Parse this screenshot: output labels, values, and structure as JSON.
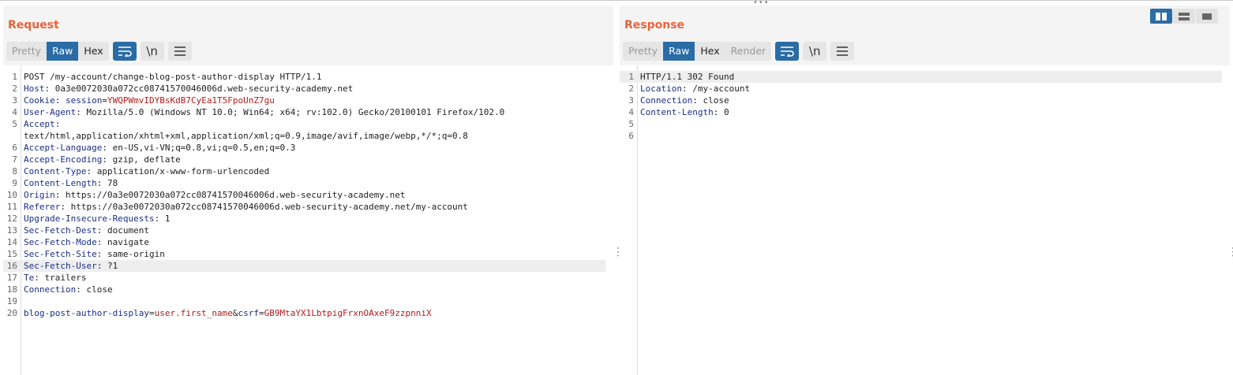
{
  "request": {
    "title": "Request",
    "tabs": [
      "Pretty",
      "Raw",
      "Hex"
    ],
    "lines": [
      {
        "n": "1",
        "k": "",
        "v": "POST /my-account/change-blog-post-author-display HTTP/1.1"
      },
      {
        "n": "2",
        "k": "Host",
        "v": "0a3e0072030a072cc08741570046006d.web-security-academy.net"
      },
      {
        "n": "3",
        "k": "Cookie",
        "v": "",
        "cookie_name": "session",
        "cookie_value": "YWQPWmvIDYBsKdB7CyEa1T5FpoUnZ7gu"
      },
      {
        "n": "4",
        "k": "User-Agent",
        "v": "Mozilla/5.0 (Windows NT 10.0; Win64; x64; rv:102.0) Gecko/20100101 Firefox/102.0"
      },
      {
        "n": "5",
        "k": "Accept",
        "v": ""
      },
      {
        "n": "",
        "k": "",
        "v": "text/html,application/xhtml+xml,application/xml;q=0.9,image/avif,image/webp,*/*;q=0.8"
      },
      {
        "n": "6",
        "k": "Accept-Language",
        "v": "en-US,vi-VN;q=0.8,vi;q=0.5,en;q=0.3"
      },
      {
        "n": "7",
        "k": "Accept-Encoding",
        "v": "gzip, deflate"
      },
      {
        "n": "8",
        "k": "Content-Type",
        "v": "application/x-www-form-urlencoded"
      },
      {
        "n": "9",
        "k": "Content-Length",
        "v": "78"
      },
      {
        "n": "10",
        "k": "Origin",
        "v": "https://0a3e0072030a072cc08741570046006d.web-security-academy.net"
      },
      {
        "n": "11",
        "k": "Referer",
        "v": "https://0a3e0072030a072cc08741570046006d.web-security-academy.net/my-account"
      },
      {
        "n": "12",
        "k": "Upgrade-Insecure-Requests",
        "v": "1"
      },
      {
        "n": "13",
        "k": "Sec-Fetch-Dest",
        "v": "document"
      },
      {
        "n": "14",
        "k": "Sec-Fetch-Mode",
        "v": "navigate"
      },
      {
        "n": "15",
        "k": "Sec-Fetch-Site",
        "v": "same-origin"
      },
      {
        "n": "16",
        "k": "Sec-Fetch-User",
        "v": "?1",
        "highlight": true
      },
      {
        "n": "17",
        "k": "Te",
        "v": "trailers"
      },
      {
        "n": "18",
        "k": "Connection",
        "v": "close"
      },
      {
        "n": "19",
        "k": "",
        "v": ""
      },
      {
        "n": "20",
        "k": "",
        "v": "",
        "body": [
          {
            "t": "blog-post-author-display",
            "c": "k"
          },
          {
            "t": "=",
            "c": ""
          },
          {
            "t": "user.first_name",
            "c": "r"
          },
          {
            "t": "&",
            "c": ""
          },
          {
            "t": "csrf",
            "c": "k"
          },
          {
            "t": "=",
            "c": ""
          },
          {
            "t": "GB9MtaYX1LbtpigFrxnOAxeF9zzpnniX",
            "c": "r"
          }
        ]
      }
    ]
  },
  "response": {
    "title": "Response",
    "tabs": [
      "Pretty",
      "Raw",
      "Hex",
      "Render"
    ],
    "lines": [
      {
        "n": "1",
        "k": "",
        "v": "HTTP/1.1 302 Found",
        "highlight": true
      },
      {
        "n": "2",
        "k": "Location",
        "v": "/my-account"
      },
      {
        "n": "3",
        "k": "Connection",
        "v": "close"
      },
      {
        "n": "4",
        "k": "Content-Length",
        "v": "0"
      },
      {
        "n": "5",
        "k": "",
        "v": ""
      },
      {
        "n": "6",
        "k": "",
        "v": ""
      }
    ]
  },
  "icons": {
    "wrap": "wrap-lines-icon",
    "newline": "\\n",
    "menu": "hamburger-menu-icon"
  },
  "colors": {
    "accent": "#e8633a",
    "active": "#2a6ca5",
    "key": "#1a2e85",
    "value": "#b31b1b"
  }
}
